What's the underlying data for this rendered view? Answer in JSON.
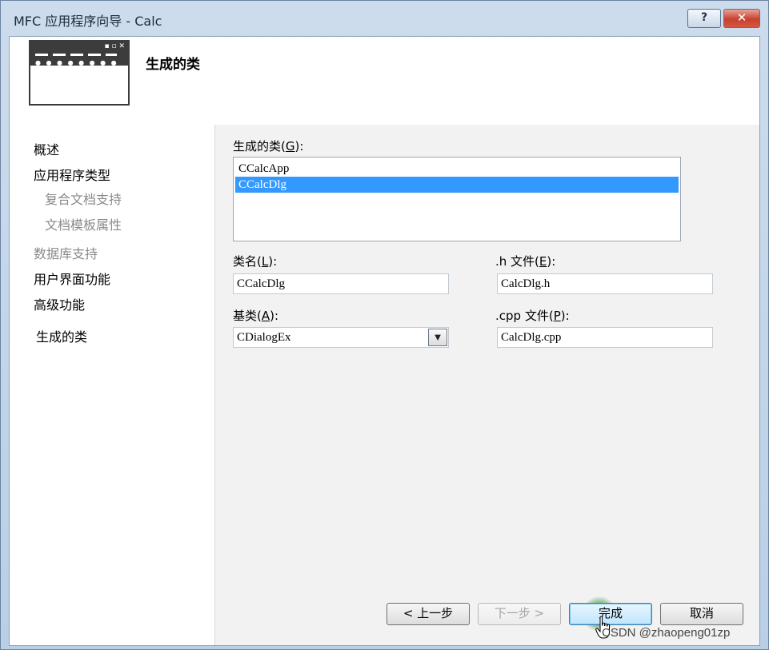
{
  "window": {
    "title": "MFC 应用程序向导 - Calc",
    "help_label": "?",
    "close_label": "✕"
  },
  "header": {
    "title": "生成的类"
  },
  "nav": {
    "items": [
      {
        "label": "概述",
        "enabled": true
      },
      {
        "label": "应用程序类型",
        "enabled": true
      },
      {
        "label": "复合文档支持",
        "enabled": false
      },
      {
        "label": "文档模板属性",
        "enabled": false
      },
      {
        "label": "数据库支持",
        "enabled": false
      },
      {
        "label": "用户界面功能",
        "enabled": true
      },
      {
        "label": "高级功能",
        "enabled": true
      },
      {
        "label": "生成的类",
        "enabled": true,
        "current": true
      }
    ]
  },
  "classes": {
    "label": "生成的类",
    "accel": "G",
    "suffix": ":",
    "items": [
      {
        "name": "CCalcApp",
        "selected": false
      },
      {
        "name": "CCalcDlg",
        "selected": true
      }
    ]
  },
  "fields": {
    "class_name": {
      "label": "类名",
      "accel": "L",
      "suffix": ":",
      "value": "CCalcDlg"
    },
    "h_file": {
      "label": ".h 文件",
      "accel": "E",
      "suffix": ":",
      "value": "CalcDlg.h"
    },
    "base_class": {
      "label": "基类",
      "accel": "A",
      "suffix": ":",
      "value": "CDialogEx"
    },
    "cpp_file": {
      "label": ".cpp 文件",
      "accel": "P",
      "suffix": ":",
      "value": "CalcDlg.cpp"
    }
  },
  "buttons": {
    "back": "< 上一步",
    "next": "下一步 >",
    "finish": "完成",
    "cancel": "取消"
  },
  "watermark": "CSDN @zhaopeng01zp",
  "colors": {
    "selection": "#3399ff",
    "panel_bg": "#f2f2f2",
    "title_bar": "#c9d9ea"
  }
}
